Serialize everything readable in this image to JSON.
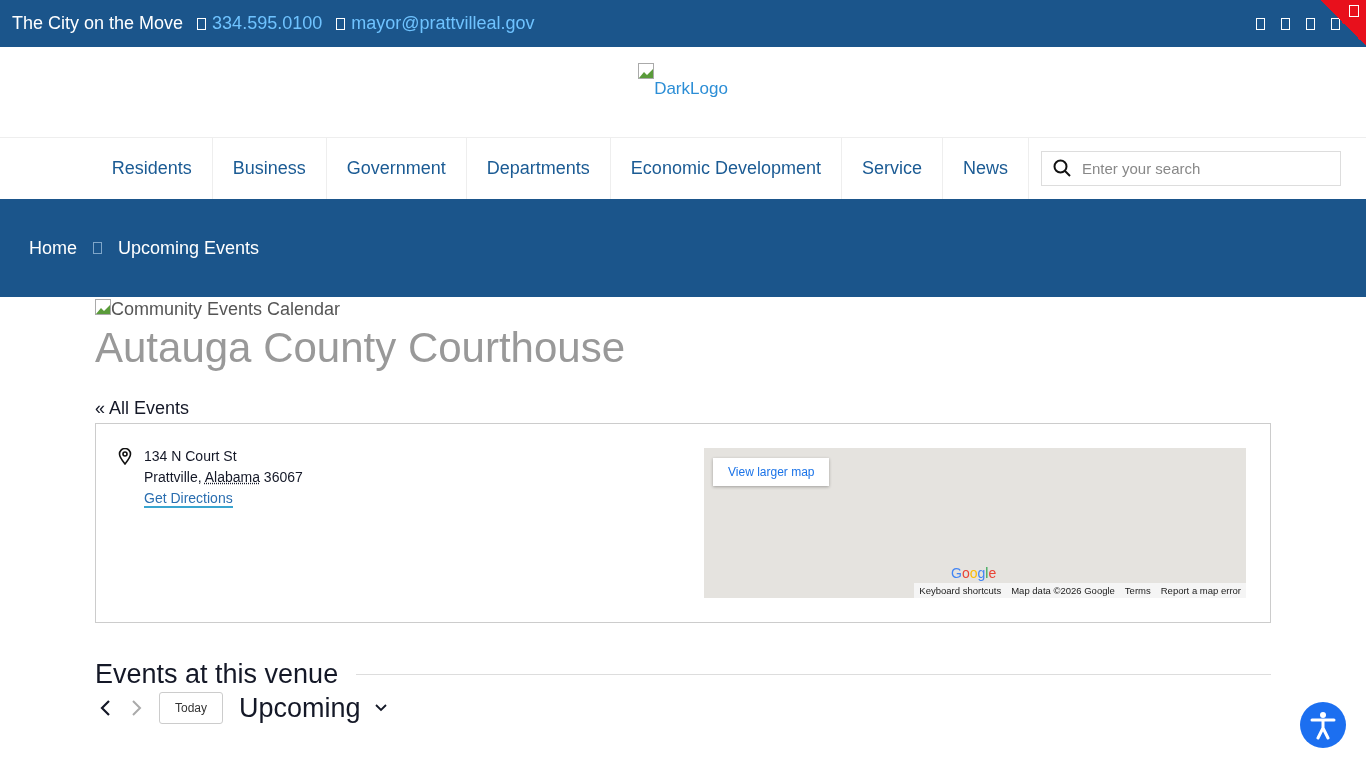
{
  "top_bar": {
    "tagline": "The City on the Move",
    "phone": "334.595.0100",
    "email": "mayor@prattvilleal.gov",
    "social": [
      {
        "kind": "link"
      },
      {
        "kind": "link"
      },
      {
        "kind": "link"
      },
      {
        "kind": "link"
      }
    ]
  },
  "logo": {
    "alt": "DarkLogo"
  },
  "nav": {
    "items": [
      {
        "label": "Residents"
      },
      {
        "label": "Business"
      },
      {
        "label": "Government"
      },
      {
        "label": "Departments"
      },
      {
        "label": "Economic Development"
      },
      {
        "label": "Service"
      },
      {
        "label": "News"
      }
    ],
    "search": {
      "placeholder": "Enter your search"
    }
  },
  "breadcrumb": [
    {
      "label": "Home"
    },
    {
      "label": "Upcoming Events"
    }
  ],
  "banner_image": {
    "alt": "Community Events Calendar"
  },
  "venue": {
    "title": "Autauga County Courthouse",
    "back_link": "« All Events",
    "address_line1": "134 N Court St",
    "city": "Prattville,",
    "state": "Alabama",
    "zip": "36067",
    "directions": "Get Directions"
  },
  "map": {
    "button": "View larger map",
    "logo": "Google",
    "attribution": [
      "Keyboard shortcuts",
      "Map data ©2026 Google",
      "Terms",
      "Report a map error"
    ]
  },
  "events": {
    "heading": "Events at this venue",
    "today": "Today",
    "view": "Upcoming",
    "next_disabled": true
  }
}
